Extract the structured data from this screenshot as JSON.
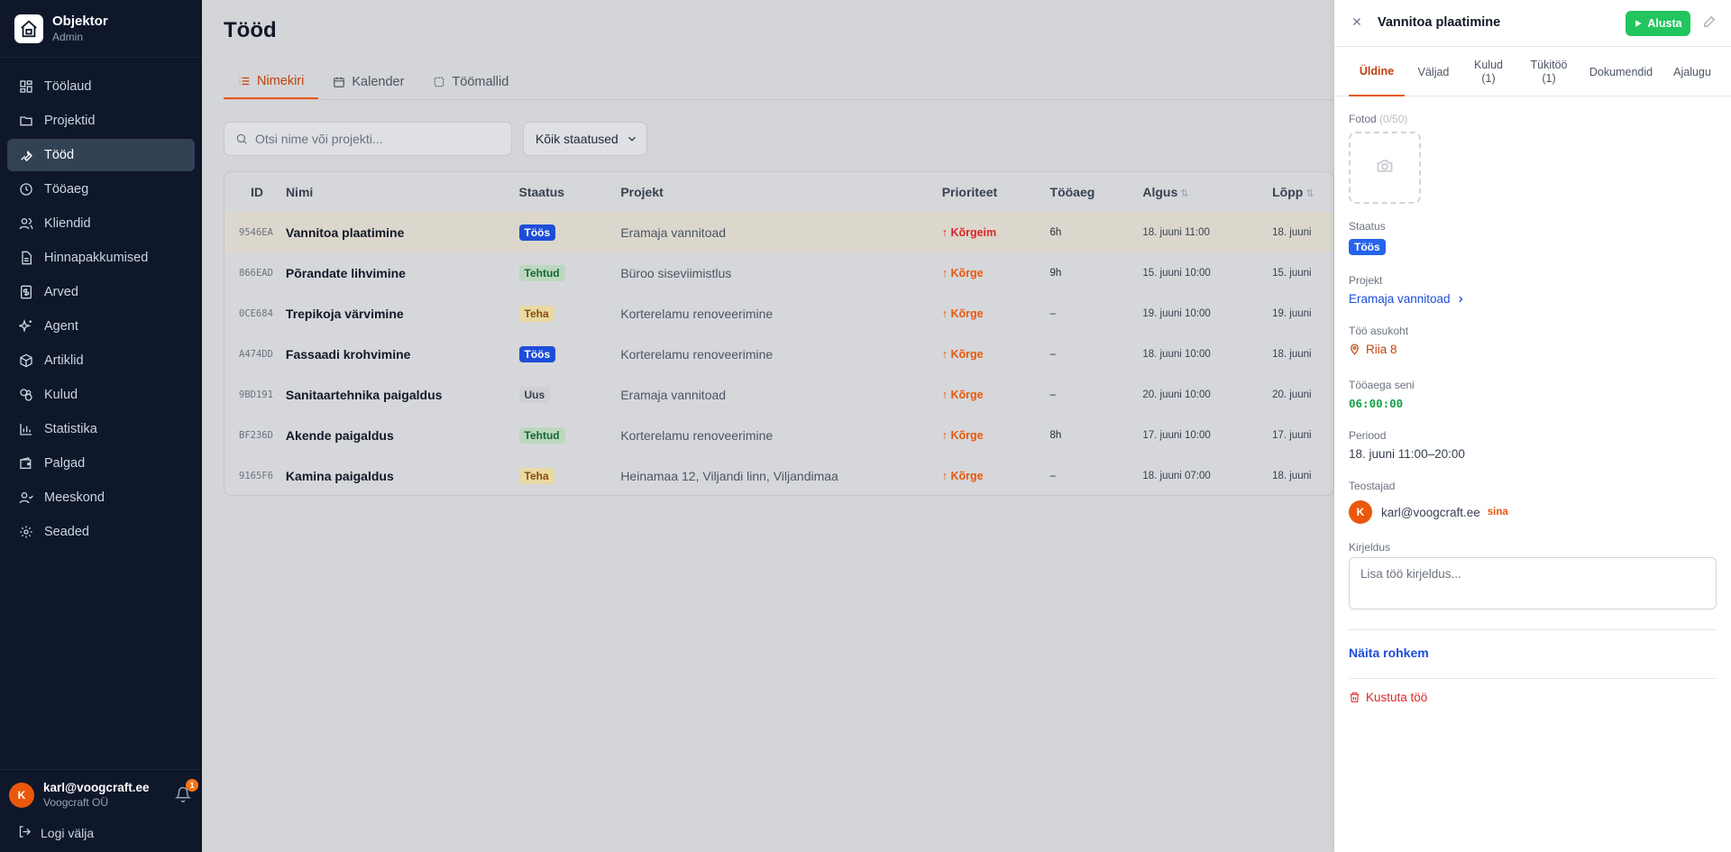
{
  "brand": {
    "name": "Objektor",
    "role": "Admin"
  },
  "sidebar": {
    "items": [
      {
        "label": "Töölaud",
        "icon": "dashboard-icon"
      },
      {
        "label": "Projektid",
        "icon": "folder-icon"
      },
      {
        "label": "Tööd",
        "icon": "wrench-icon",
        "active": true
      },
      {
        "label": "Tööaeg",
        "icon": "clock-icon"
      },
      {
        "label": "Kliendid",
        "icon": "users-icon"
      },
      {
        "label": "Hinnapakkumised",
        "icon": "document-icon"
      },
      {
        "label": "Arved",
        "icon": "invoice-icon"
      },
      {
        "label": "Agent",
        "icon": "sparkle-icon"
      },
      {
        "label": "Artiklid",
        "icon": "box-icon"
      },
      {
        "label": "Kulud",
        "icon": "coins-icon"
      },
      {
        "label": "Statistika",
        "icon": "chart-icon"
      },
      {
        "label": "Palgad",
        "icon": "wallet-icon"
      },
      {
        "label": "Meeskond",
        "icon": "team-icon"
      },
      {
        "label": "Seaded",
        "icon": "gear-icon"
      }
    ],
    "user": {
      "initial": "K",
      "email": "karl@voogcraft.ee",
      "org": "Voogcraft OÜ",
      "notifications": "1"
    },
    "logout_label": "Logi välja"
  },
  "main": {
    "title": "Tööd",
    "tabs": [
      {
        "label": "Nimekiri",
        "icon": "list-icon"
      },
      {
        "label": "Kalender",
        "icon": "calendar-icon"
      },
      {
        "label": "Töömallid",
        "icon": "template-icon"
      }
    ],
    "search_placeholder": "Otsi nime või projekti...",
    "status_filter": "Kõik staatused"
  },
  "table": {
    "headers": {
      "id": "ID",
      "name": "Nimi",
      "status": "Staatus",
      "project": "Projekt",
      "priority": "Prioriteet",
      "time": "Tööaeg",
      "start": "Algus",
      "end": "Lõpp"
    },
    "rows": [
      {
        "id": "9546EA",
        "name": "Vannitoa plaatimine",
        "status": "Töös",
        "status_kind": "toos",
        "project": "Eramaja vannitoad",
        "priority": "↑ Kõrgeim",
        "priority_kind": "top",
        "time": "6h",
        "start": "18. juuni 11:00",
        "end": "18. juuni"
      },
      {
        "id": "866EAD",
        "name": "Põrandate lihvimine",
        "status": "Tehtud",
        "status_kind": "tehtud",
        "project": "Büroo siseviimistlus",
        "priority": "↑ Kõrge",
        "priority_kind": "high",
        "time": "9h",
        "start": "15. juuni 10:00",
        "end": "15. juuni"
      },
      {
        "id": "0CE684",
        "name": "Trepikoja värvimine",
        "status": "Teha",
        "status_kind": "teha",
        "project": "Korterelamu renoveerimine",
        "priority": "↑ Kõrge",
        "priority_kind": "high",
        "time": "–",
        "start": "19. juuni 10:00",
        "end": "19. juuni"
      },
      {
        "id": "A474DD",
        "name": "Fassaadi krohvimine",
        "status": "Töös",
        "status_kind": "toos",
        "project": "Korterelamu renoveerimine",
        "priority": "↑ Kõrge",
        "priority_kind": "high",
        "time": "–",
        "start": "18. juuni 10:00",
        "end": "18. juuni"
      },
      {
        "id": "9BD191",
        "name": "Sanitaartehnika paigaldus",
        "status": "Uus",
        "status_kind": "uus",
        "project": "Eramaja vannitoad",
        "priority": "↑ Kõrge",
        "priority_kind": "high",
        "time": "–",
        "start": "20. juuni 10:00",
        "end": "20. juuni"
      },
      {
        "id": "BF236D",
        "name": "Akende paigaldus",
        "status": "Tehtud",
        "status_kind": "tehtud",
        "project": "Korterelamu renoveerimine",
        "priority": "↑ Kõrge",
        "priority_kind": "high",
        "time": "8h",
        "start": "17. juuni 10:00",
        "end": "17. juuni"
      },
      {
        "id": "9165F6",
        "name": "Kamina paigaldus",
        "status": "Teha",
        "status_kind": "teha",
        "project": "Heinamaa 12, Viljandi linn, Viljandimaa",
        "priority": "↑ Kõrge",
        "priority_kind": "high",
        "time": "–",
        "start": "18. juuni 07:00",
        "end": "18. juuni"
      }
    ]
  },
  "panel": {
    "title": "Vannitoa plaatimine",
    "start_label": "Alusta",
    "tabs": [
      "Üldine",
      "Väljad",
      "Kulud\n(1)",
      "Tükitöö\n(1)",
      "Dokumendid",
      "Ajalugu"
    ],
    "photos_label": "Fotod",
    "photos_count": "(0/50)",
    "status_label": "Staatus",
    "status_value": "Töös",
    "project_label": "Projekt",
    "project_value": "Eramaja vannitoad",
    "location_label": "Töö asukoht",
    "location_value": "Riia 8",
    "time_label": "Tööaega seni",
    "time_value": "06:00:00",
    "period_label": "Periood",
    "period_value": "18. juuni 11:00–20:00",
    "assignees_label": "Teostajad",
    "assignee_initial": "K",
    "assignee_email": "karl@voogcraft.ee",
    "assignee_tag": "sina",
    "description_label": "Kirjeldus",
    "description_placeholder": "Lisa töö kirjeldus...",
    "show_more": "Näita rohkem",
    "delete_label": "Kustuta töö"
  },
  "colors": {
    "accent": "#ea580c",
    "sidebar_bg": "#0f172a",
    "start_green": "#22c55e",
    "link_blue": "#1d4ed8"
  }
}
